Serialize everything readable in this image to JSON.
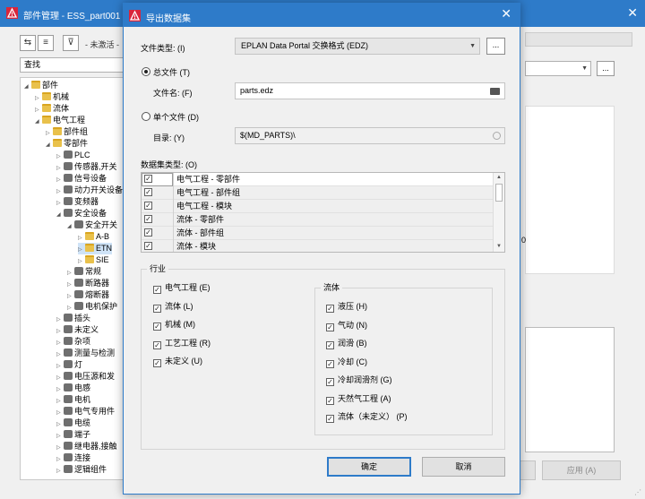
{
  "bg_window": {
    "title": "部件管理 - ESS_part001",
    "filter_label": "- 未激活 -",
    "search_placeholder": "查找",
    "tree": [
      {
        "label": "部件",
        "level": 0
      },
      {
        "label": "机械",
        "level": 1
      },
      {
        "label": "流体",
        "level": 1
      },
      {
        "label": "电气工程",
        "level": 1
      },
      {
        "label": "部件组",
        "level": 2
      },
      {
        "label": "零部件",
        "level": 2
      },
      {
        "label": "PLC",
        "level": 3
      },
      {
        "label": "传感器,开关",
        "level": 3
      },
      {
        "label": "信号设备",
        "level": 3
      },
      {
        "label": "动力开关设备",
        "level": 3
      },
      {
        "label": "变频器",
        "level": 3
      },
      {
        "label": "安全设备",
        "level": 3
      },
      {
        "label": "安全开关",
        "level": 4
      },
      {
        "label": "A-B",
        "level": 5
      },
      {
        "label": "ETN",
        "level": 5
      },
      {
        "label": "SIE",
        "level": 5
      },
      {
        "label": "常规",
        "level": 4
      },
      {
        "label": "断路器",
        "level": 4
      },
      {
        "label": "熔断器",
        "level": 4
      },
      {
        "label": "电机保护",
        "level": 4
      },
      {
        "label": "插头",
        "level": 3
      },
      {
        "label": "未定义",
        "level": 3
      },
      {
        "label": "杂项",
        "level": 3
      },
      {
        "label": "测量与检测",
        "level": 3
      },
      {
        "label": "灯",
        "level": 3
      },
      {
        "label": "电压源和发",
        "level": 3
      },
      {
        "label": "电感",
        "level": 3
      },
      {
        "label": "电机",
        "level": 3
      },
      {
        "label": "电气专用件",
        "level": 3
      },
      {
        "label": "电缆",
        "level": 3
      },
      {
        "label": "端子",
        "level": 3
      },
      {
        "label": "继电器,接触",
        "level": 3
      },
      {
        "label": "连接",
        "level": 3
      },
      {
        "label": "逻辑组件",
        "level": 3
      }
    ],
    "right_zero": "0",
    "apply_label": "应用 (A)"
  },
  "dialog": {
    "title": "导出数据集",
    "file_type_label": "文件类型: (I)",
    "file_type_value": "EPLAN Data Portal 交换格式 (EDZ)",
    "dots_label": "...",
    "radio_total_label": "总文件 (T)",
    "filename_label": "文件名: (F)",
    "filename_value": "parts.edz",
    "radio_single_label": "单个文件 (D)",
    "directory_label": "目录: (Y)",
    "directory_value": "$(MD_PARTS)\\",
    "dataset_type_label": "数据集类型: (O)",
    "dataset_types": [
      {
        "label": "电气工程 - 零部件",
        "checked": true
      },
      {
        "label": "电气工程 - 部件组",
        "checked": true
      },
      {
        "label": "电气工程 - 模块",
        "checked": true
      },
      {
        "label": "流体 - 零部件",
        "checked": true
      },
      {
        "label": "流体 - 部件组",
        "checked": true
      },
      {
        "label": "流体 - 模块",
        "checked": true
      }
    ],
    "industry_label": "行业",
    "industry": [
      {
        "label": "电气工程 (E)",
        "checked": true
      },
      {
        "label": "流体 (L)",
        "checked": true
      },
      {
        "label": "机械 (M)",
        "checked": true
      },
      {
        "label": "工艺工程 (R)",
        "checked": true
      },
      {
        "label": "未定义 (U)",
        "checked": true
      }
    ],
    "fluid_label": "流体",
    "fluid": [
      {
        "label": "液压 (H)",
        "checked": true
      },
      {
        "label": "气动 (N)",
        "checked": true
      },
      {
        "label": "润滑 (B)",
        "checked": true
      },
      {
        "label": "冷却 (C)",
        "checked": true
      },
      {
        "label": "冷却润滑剂 (G)",
        "checked": true
      },
      {
        "label": "天然气工程 (A)",
        "checked": true
      },
      {
        "label": "流体（未定义） (P)",
        "checked": true
      }
    ],
    "ok_label": "确定",
    "cancel_label": "取消",
    "check_mark": "✓"
  },
  "colors": {
    "titlebar": "#2e7bc9",
    "app_icon": "#d9263b"
  }
}
